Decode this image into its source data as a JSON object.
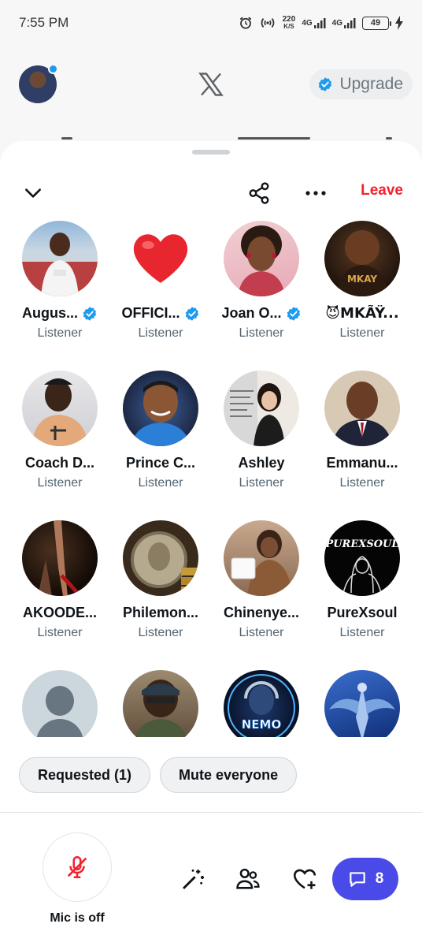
{
  "status_bar": {
    "time": "7:55 PM",
    "net_speed": "220",
    "net_unit": "K/S",
    "net1": "4G",
    "net2": "4G",
    "battery": "49"
  },
  "header": {
    "upgrade_label": "Upgrade"
  },
  "space": {
    "leave_label": "Leave"
  },
  "participants": [
    {
      "name": "Augus...",
      "role": "Listener",
      "verified": true
    },
    {
      "name": "OFFICI...",
      "role": "Listener",
      "verified": true
    },
    {
      "name": "Joan O...",
      "role": "Listener",
      "verified": true
    },
    {
      "name": "😈MKÃŸ...",
      "role": "Listener",
      "verified": false
    },
    {
      "name": "Coach D...",
      "role": "Listener",
      "verified": false
    },
    {
      "name": "Prince C...",
      "role": "Listener",
      "verified": false
    },
    {
      "name": "Ashley",
      "role": "Listener",
      "verified": false
    },
    {
      "name": "Emmanu...",
      "role": "Listener",
      "verified": false
    },
    {
      "name": "AKOODE...",
      "role": "Listener",
      "verified": false
    },
    {
      "name": "Philemon...",
      "role": "Listener",
      "verified": false
    },
    {
      "name": "Chinenye...",
      "role": "Listener",
      "verified": false
    },
    {
      "name": "PureXsoul",
      "role": "Listener",
      "verified": false
    },
    {
      "name": "",
      "role": "",
      "verified": false
    },
    {
      "name": "",
      "role": "",
      "verified": false
    },
    {
      "name": "",
      "role": "",
      "verified": false
    },
    {
      "name": "",
      "role": "",
      "verified": false
    }
  ],
  "avatar_texts": {
    "mkay": "MKAY",
    "purexsoul": "PUREXSOUL",
    "nemo": "NEMO"
  },
  "actions": {
    "requested_label": "Requested (1)",
    "mute_everyone_label": "Mute everyone",
    "mic_label": "Mic is off",
    "chat_count": "8"
  },
  "colors": {
    "accent": "#1d9bf0",
    "leave": "#f4212e",
    "chat": "#4a4ae8",
    "mic_off": "#f4212e"
  },
  "icons": [
    "alarm-icon",
    "hotspot-icon",
    "signal-icon",
    "battery-icon",
    "charging-icon",
    "x-logo-icon",
    "verified-badge-icon",
    "chevron-down-icon",
    "share-icon",
    "more-icon",
    "mic-off-icon",
    "magic-wand-icon",
    "people-icon",
    "heart-plus-icon",
    "chat-icon",
    "heart-icon"
  ]
}
